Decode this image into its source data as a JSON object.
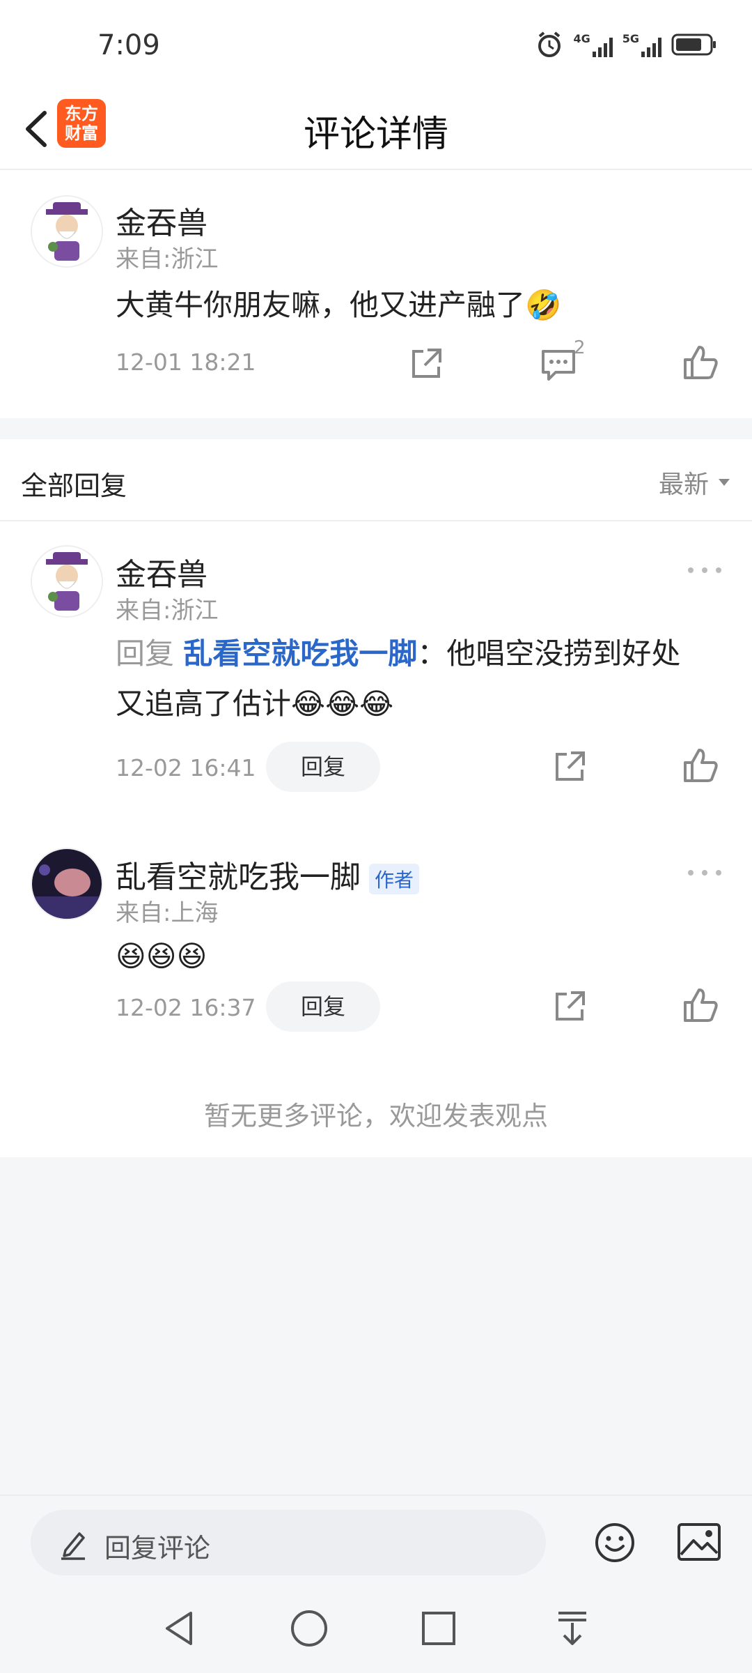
{
  "status_bar": {
    "time": "7:09",
    "network_labels": [
      "4G",
      "5G"
    ],
    "icons": [
      "alarm-icon",
      "signal-4g-icon",
      "signal-5g-icon",
      "battery-icon"
    ]
  },
  "header": {
    "title": "评论详情",
    "logo_line1": "东方",
    "logo_line2": "财富"
  },
  "main_comment": {
    "user": "金吞兽",
    "from": "来自:浙江",
    "text": "大黄牛你朋友嘛，他又进产融了",
    "emoji": "🤣",
    "time": "12-01 18:21",
    "reply_count": "2"
  },
  "replies_section": {
    "title": "全部回复",
    "sort_label": "最新",
    "items": [
      {
        "user": "金吞兽",
        "from": "来自:浙江",
        "reply_prefix": "回复",
        "mention": "乱看空就吃我一脚",
        "separator": "：",
        "text_line1": "他唱空没捞到好处",
        "text_line2": "又追高了估计",
        "emoji": "😂😂😂",
        "time": "12-02 16:41",
        "reply_button": "回复"
      },
      {
        "user": "乱看空就吃我一脚",
        "author_tag": "作者",
        "from": "来自:上海",
        "emoji": "😆😆😆",
        "time": "12-02 16:37",
        "reply_button": "回复"
      }
    ],
    "end_message": "暂无更多评论，欢迎发表观点"
  },
  "input_bar": {
    "placeholder": "回复评论"
  },
  "colors": {
    "accent_blue": "#2a67c9",
    "brand_orange": "#ff5a1f",
    "background": "#f5f6f8"
  }
}
